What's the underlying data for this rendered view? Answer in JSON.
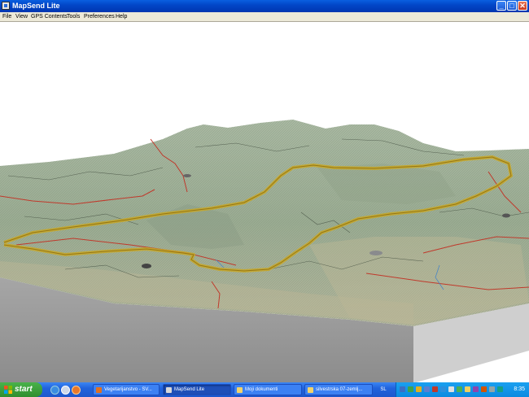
{
  "window": {
    "title": "MapSend Lite"
  },
  "window_controls": {
    "minimize": "_",
    "maximize": "□",
    "close": "✕"
  },
  "menu": [
    "File",
    "View",
    "GPS Contents",
    "Tools",
    "Preferences",
    "Help"
  ],
  "taskbar": {
    "start_label": "start",
    "tasks": [
      {
        "label": "Vegetarijanstvo - SV...",
        "icon_color": "#e07020",
        "active": false
      },
      {
        "label": "MapSend Lite",
        "icon_color": "#d8d8d8",
        "active": true
      },
      {
        "label": "Moji dokumenti",
        "icon_color": "#f2d36b",
        "active": false
      },
      {
        "label": "silvestrska 07-zemlj...",
        "icon_color": "#f2d36b",
        "active": false
      }
    ],
    "language": "SL",
    "clock": "8:35"
  },
  "colors": {
    "title_bar": "#0247c8",
    "menu_bar": "#ece9d8",
    "terrain": "#9fb39a",
    "track": "#c9a825",
    "roads": "#c0392b",
    "taskbar": "#2163dd",
    "start_button": "#3a9e3a"
  }
}
